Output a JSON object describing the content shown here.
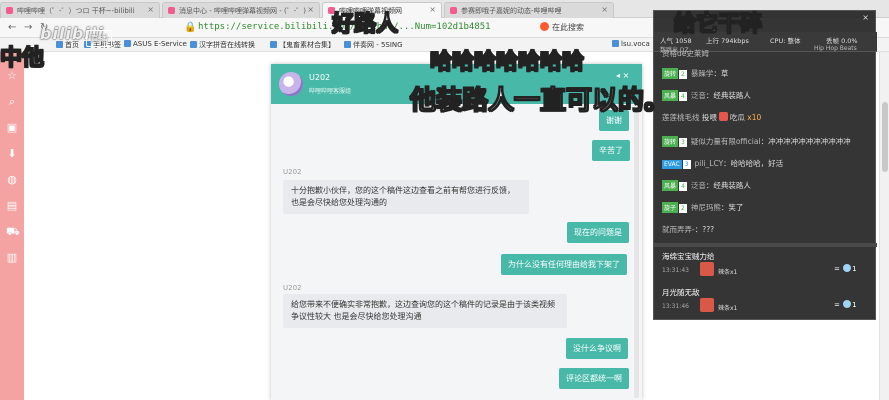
{
  "browser": {
    "tabs": [
      {
        "label": "哔哩哔哩（゜-゜）つロ 干杯~-bilibili"
      },
      {
        "label": "消息中心 - 哔哩哔哩弹幕视频网 - (゜-゜)"
      },
      {
        "label": "哔哩哔哩弹幕视频网"
      },
      {
        "label": "参赛即哦子嘉妮的动态-哔哩哔哩"
      }
    ],
    "url": "https://service.bilibili.com/v2/chat/...Num=102d1b4851",
    "search_label": "在此搜索",
    "bookmarks": [
      {
        "label": "首页"
      },
      {
        "label": "手机书签"
      },
      {
        "label": "ASUS E-Service"
      },
      {
        "label": "汉字拼音在线转换"
      },
      {
        "label": "【鬼畜素材合集】"
      },
      {
        "label": "伴奏网 - 5SING"
      },
      {
        "label": "lsu.voca"
      }
    ]
  },
  "watermark": {
    "logo": "bilibili",
    "badge": "直播"
  },
  "chat": {
    "title": "U202",
    "subtitle": "哔哩哔哩客服组",
    "messages": [
      {
        "side": "right",
        "text": "谢谢"
      },
      {
        "side": "right",
        "text": "辛苦了"
      },
      {
        "side": "left",
        "sender": "U202",
        "text": "十分抱歉小伙伴，您的这个稿件这边查看之前有帮您进行反馈，也是会尽快给您处理沟通的"
      },
      {
        "side": "right",
        "text": "现在的问题是"
      },
      {
        "side": "right",
        "text": "为什么没有任何理由给我下架了"
      },
      {
        "side": "left",
        "sender": "U202",
        "text": "给您带来不便确实非常抱歉，这边查询您的这个稿件的记录是由于该类视频争议性较大 也是会尽快给您处理沟通"
      },
      {
        "side": "right",
        "text": "没什么争议啊"
      },
      {
        "side": "right",
        "text": "评论区都统一啊"
      }
    ]
  },
  "overlay": {
    "top_left": "中他",
    "top_mid": "好路人",
    "top_right": "给它干碎",
    "line1": "哈哈哈哈哈哈哈",
    "line2": "他装路人一直可以的。"
  },
  "danmaku": {
    "stats": {
      "popularity": "人气 1058",
      "bitrate": "上行 794kbps",
      "cpu": "CPU: 整体",
      "loss": "丢帧 0.0%",
      "sub_left": "数跳出 DZ",
      "sub_right": "Hip Hop Beats"
    },
    "rows": [
      {
        "user": "资格de史莱姆",
        "text": ""
      },
      {
        "medal": "旋转",
        "level": "2",
        "user": "暴躁学",
        "text": "草"
      },
      {
        "medal": "风暴",
        "level": "4",
        "user": "泛音",
        "text": "经典装路人"
      },
      {
        "medal": "",
        "level": "",
        "user": "莲莲桃毛线",
        "text": "投喂",
        "gift": "吃瓜",
        "count": "x10"
      },
      {
        "medal": "旋转",
        "level": "3",
        "user": "疑似力量有限official",
        "text": "冲冲冲冲冲冲冲冲冲冲冲"
      },
      {
        "medal": "EVAC",
        "level": "3",
        "user": "pili_LCY",
        "text": "哈哈哈哈，好活"
      },
      {
        "medal": "风暴",
        "level": "4",
        "user": "泛音",
        "text": "经典装路人"
      },
      {
        "medal": "旋子",
        "level": "2",
        "user": "神尼玛熊",
        "text": "笑了"
      },
      {
        "medal": "",
        "level": "",
        "user": "就而弄弄-",
        "text": "???"
      }
    ],
    "superchats": [
      {
        "name": "海绵宝宝贼力给",
        "time": "13:31:43",
        "gift": "辣条x1",
        "value": "1"
      },
      {
        "name": "月光随无敌",
        "time": "13:31:46",
        "gift": "辣条x1",
        "value": "1"
      }
    ]
  }
}
